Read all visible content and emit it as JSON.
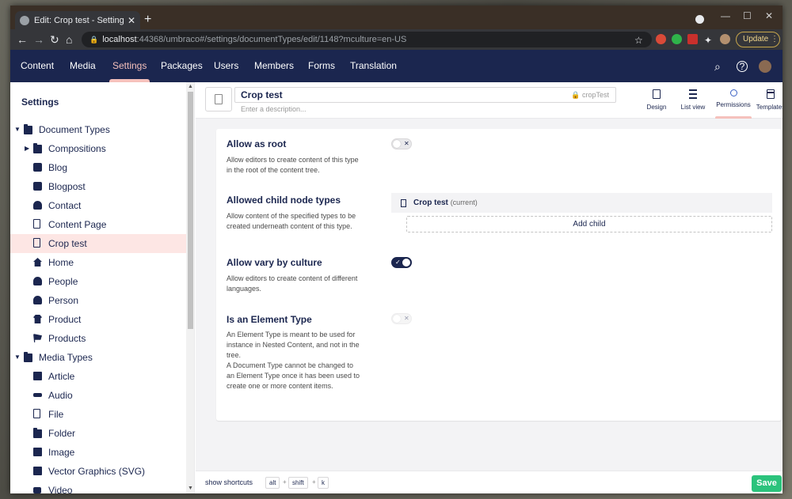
{
  "browser": {
    "tab_title": "Edit: Crop test - Settings - localh",
    "url_host": "localhost",
    "url_rest": ":44368/umbraco#/settings/documentTypes/edit/1148?mculture=en-US",
    "update_label": "Update"
  },
  "topnav": {
    "items": [
      "Content",
      "Media",
      "Settings",
      "Packages",
      "Users",
      "Members",
      "Forms",
      "Translation"
    ],
    "active": "Settings"
  },
  "sidebar": {
    "title": "Settings",
    "tree": [
      {
        "label": "Document Types",
        "icon": "folder-icon",
        "level": 0,
        "expanded": true
      },
      {
        "label": "Compositions",
        "icon": "folder-icon",
        "level": 1,
        "collapsed": true
      },
      {
        "label": "Blog",
        "icon": "calendar-icon",
        "level": 1
      },
      {
        "label": "Blogpost",
        "icon": "calendar-icon",
        "level": 1
      },
      {
        "label": "Contact",
        "icon": "user-pin-icon",
        "level": 1
      },
      {
        "label": "Content Page",
        "icon": "document-icon",
        "level": 1
      },
      {
        "label": "Crop test",
        "icon": "document-icon",
        "level": 1,
        "selected": true
      },
      {
        "label": "Home",
        "icon": "home-icon",
        "level": 1
      },
      {
        "label": "People",
        "icon": "people-icon",
        "level": 1
      },
      {
        "label": "Person",
        "icon": "person-icon",
        "level": 1
      },
      {
        "label": "Product",
        "icon": "shirt-icon",
        "level": 1
      },
      {
        "label": "Products",
        "icon": "cart-icon",
        "level": 1
      },
      {
        "label": "Media Types",
        "icon": "folder-icon",
        "level": 0,
        "expanded": true
      },
      {
        "label": "Article",
        "icon": "article-icon",
        "level": 1
      },
      {
        "label": "Audio",
        "icon": "audio-icon",
        "level": 1
      },
      {
        "label": "File",
        "icon": "document-icon",
        "level": 1
      },
      {
        "label": "Folder",
        "icon": "folder-icon",
        "level": 1
      },
      {
        "label": "Image",
        "icon": "image-icon",
        "level": 1
      },
      {
        "label": "Vector Graphics (SVG)",
        "icon": "image-icon",
        "level": 1
      },
      {
        "label": "Video",
        "icon": "video-icon",
        "level": 1
      }
    ]
  },
  "editor": {
    "name": "Crop test",
    "alias": "cropTest",
    "description_placeholder": "Enter a description...",
    "apps": [
      "Design",
      "List view",
      "Permissions",
      "Templates"
    ],
    "active_app": "Permissions"
  },
  "permissions": {
    "allow_as_root": {
      "label": "Allow as root",
      "description": "Allow editors to create content of this type in the root of the content tree.",
      "value": false
    },
    "allowed_child": {
      "label": "Allowed child node types",
      "description": "Allow content of the specified types to be created underneath content of this type.",
      "child_name": "Crop test",
      "child_suffix": "(current)",
      "add_label": "Add child"
    },
    "allow_vary": {
      "label": "Allow vary by culture",
      "description": "Allow editors to create content of different languages.",
      "value": true
    },
    "element_type": {
      "label": "Is an Element Type",
      "description_1": "An Element Type is meant to be used for instance in Nested Content, and not in the tree.",
      "description_2": "A Document Type cannot be changed to an Element Type once it has been used to create one or more content items.",
      "value": false
    }
  },
  "footer": {
    "shortcuts_label": "show shortcuts",
    "keys": [
      "alt",
      "shift",
      "k"
    ],
    "save_label": "Save"
  },
  "colors": {
    "nav_bg": "#1b264f",
    "accent": "#f5c1bc",
    "save": "#2bc37c"
  }
}
